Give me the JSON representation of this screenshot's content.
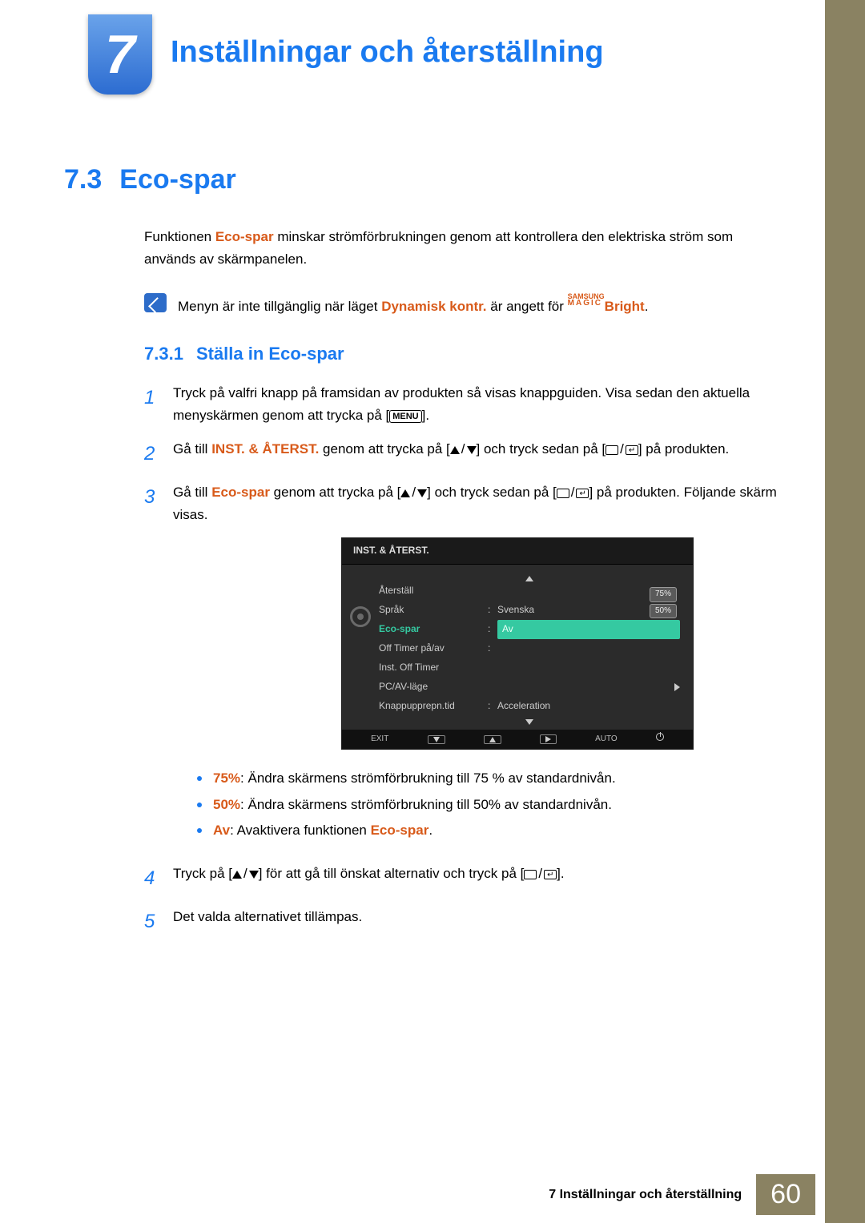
{
  "chapter": {
    "number": "7",
    "title": "Inställningar och återställning"
  },
  "section": {
    "number": "7.3",
    "title": "Eco-spar"
  },
  "intro": {
    "p1_a": "Funktionen ",
    "p1_b": "Eco-spar",
    "p1_c": " minskar strömförbrukningen genom att kontrollera den elektriska ström som används av skärmpanelen."
  },
  "note": {
    "a": "Menyn är inte tillgänglig när läget ",
    "b": "Dynamisk kontr.",
    "c": " är angett för ",
    "magic1": "SAMSUNG",
    "magic2": "MAGIC",
    "d": "Bright",
    "e": "."
  },
  "subsection": {
    "number": "7.3.1",
    "title": "Ställa in Eco-spar"
  },
  "steps": {
    "s1_a": "Tryck på valfri knapp på framsidan av produkten så visas knappguiden. Visa sedan den aktuella menyskärmen genom att trycka på [",
    "s1_menu": "MENU",
    "s1_b": "].",
    "s2_a": "Gå till ",
    "s2_b": "INST. & ÅTERST.",
    "s2_c": " genom att trycka på [",
    "s2_d": "] och tryck sedan på [",
    "s2_e": "] på produkten.",
    "s3_a": "Gå till ",
    "s3_b": "Eco-spar",
    "s3_c": " genom att trycka på [",
    "s3_d": "] och tryck sedan på [",
    "s3_e": "] på produkten. Följande skärm visas.",
    "s4_a": "Tryck på [",
    "s4_b": "] för att gå till önskat alternativ och tryck på [",
    "s4_c": "].",
    "s5": "Det valda alternativet tillämpas."
  },
  "osd": {
    "title": "INST. & ÅTERST.",
    "items": {
      "reset": "Återställ",
      "lang": "Språk",
      "lang_val": "Svenska",
      "eco": "Eco-spar",
      "eco_val": "Av",
      "offtimer": "Off Timer på/av",
      "instoff": "Inst. Off Timer",
      "pcav": "PC/AV-läge",
      "keyrep": "Knappupprepn.tid",
      "keyrep_val": "Acceleration"
    },
    "bubbles": {
      "b1": "75%",
      "b2": "50%"
    },
    "bottom": {
      "exit": "EXIT",
      "auto": "AUTO"
    }
  },
  "bullets": {
    "b1a": "75%",
    "b1b": ": Ändra skärmens strömförbrukning till 75 % av standardnivån.",
    "b2a": "50%",
    "b2b": ": Ändra skärmens strömförbrukning till 50% av standardnivån.",
    "b3a": "Av",
    "b3b": ": Avaktivera funktionen ",
    "b3c": "Eco-spar",
    "b3d": "."
  },
  "footer": {
    "text": "7 Inställningar och återställning",
    "page": "60"
  }
}
